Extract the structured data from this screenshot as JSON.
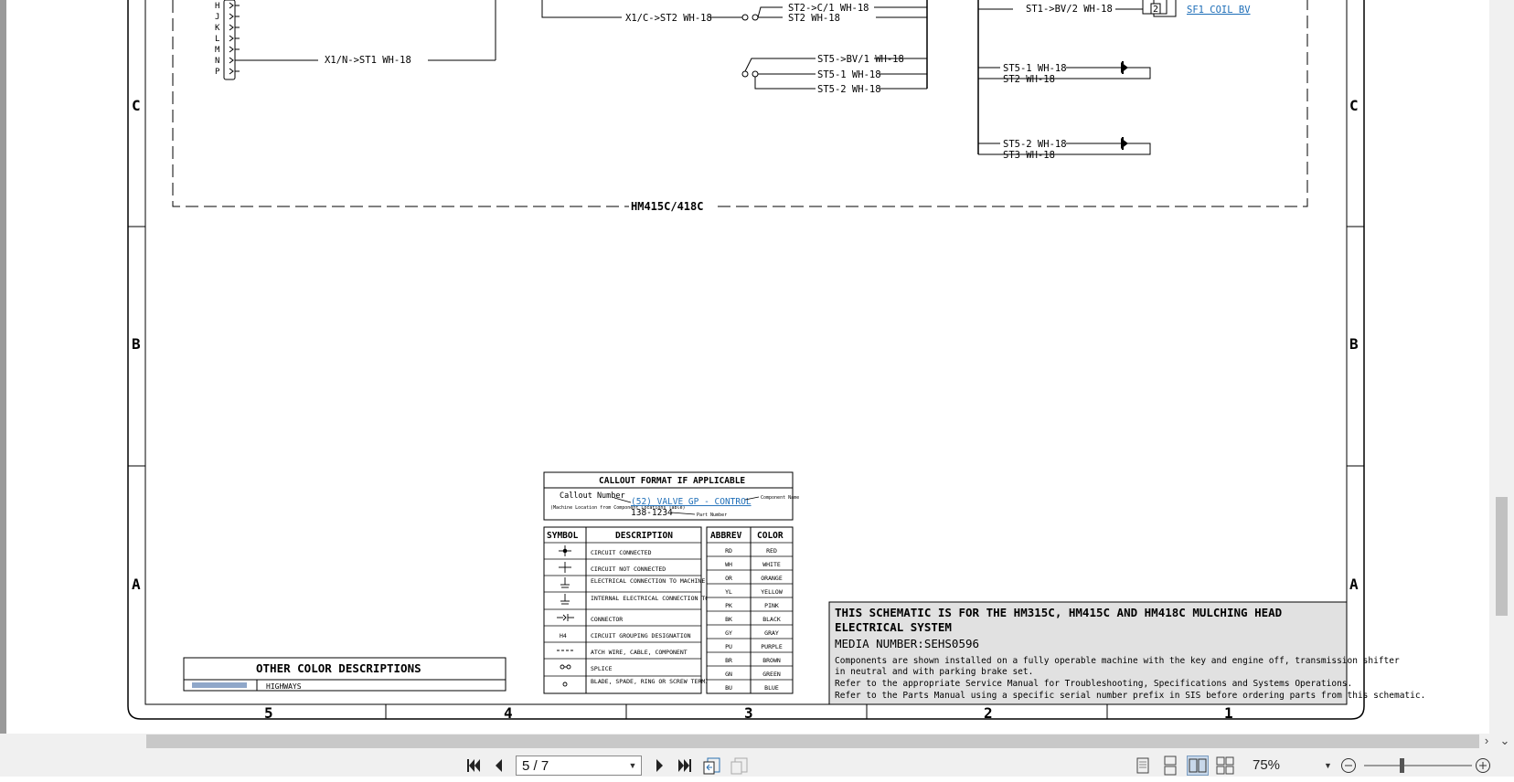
{
  "schematic": {
    "pins": [
      "H",
      "J",
      "K",
      "L",
      "M",
      "N",
      "P"
    ],
    "wires": {
      "x1n_st1": "X1/N->ST1 WH-18",
      "x1c_st2": "X1/C->ST2 WH-18",
      "st2_c1": "ST2->C/1 WH-18",
      "st2": "ST2 WH-18",
      "st5_bv1": "ST5->BV/1 WH-18",
      "st5_1": "ST5-1 WH-18",
      "st5_2": "ST5-2 WH-18",
      "st1_bv2": "ST1->BV/2 WH-18",
      "st5_1b": "ST5-1 WH-18",
      "st2b": "ST2 WH-18",
      "st5_2b": "ST5-2 WH-18",
      "st3": "ST3 WH-18"
    },
    "component_link": "SF1 COIL BV",
    "connector_pin": "2",
    "zone_label": "HM415C/418C"
  },
  "border": {
    "rows": [
      "C",
      "B",
      "A"
    ],
    "columns": [
      "5",
      "4",
      "3",
      "2",
      "1"
    ]
  },
  "callout": {
    "title": "CALLOUT FORMAT IF APPLICABLE",
    "callout_number": "Callout Number",
    "callout_note": "(Machine Location from Component Locations Table)",
    "link": "(52) VALVE GP - CONTROL",
    "component_name": "Component Name",
    "part_number_value": "138-1234",
    "part_number_label": "Part Number"
  },
  "symbol_table": {
    "headers": [
      "SYMBOL",
      "DESCRIPTION"
    ],
    "rows": [
      {
        "icon": "circuit-connected-icon",
        "desc": "CIRCUIT CONNECTED"
      },
      {
        "icon": "circuit-not-connected-icon",
        "desc": "CIRCUIT NOT CONNECTED"
      },
      {
        "icon": "ground-structure-icon",
        "desc": "ELECTRICAL CONNECTION TO MACHINE STRUCTURE"
      },
      {
        "icon": "ground-internal-icon",
        "desc": "INTERNAL ELECTRICAL CONNECTION TO SURFACE OF COMPONENT"
      },
      {
        "icon": "connector-icon",
        "desc": "CONNECTOR"
      },
      {
        "icon": "grouping-icon",
        "symbol_text": "H4",
        "desc": "CIRCUIT GROUPING DESIGNATION"
      },
      {
        "icon": "attach-wire-icon",
        "desc": "ATCH WIRE, CABLE, COMPONENT"
      },
      {
        "icon": "splice-icon",
        "desc": "SPLICE"
      },
      {
        "icon": "terminal-icon",
        "desc": "BLADE, SPADE, RING OR SCREW TERMINAL"
      }
    ]
  },
  "color_table": {
    "headers": [
      "ABBREV",
      "COLOR"
    ],
    "rows": [
      [
        "RD",
        "RED"
      ],
      [
        "WH",
        "WHITE"
      ],
      [
        "OR",
        "ORANGE"
      ],
      [
        "YL",
        "YELLOW"
      ],
      [
        "PK",
        "PINK"
      ],
      [
        "BK",
        "BLACK"
      ],
      [
        "GY",
        "GRAY"
      ],
      [
        "PU",
        "PURPLE"
      ],
      [
        "BR",
        "BROWN"
      ],
      [
        "GN",
        "GREEN"
      ],
      [
        "BU",
        "BLUE"
      ]
    ]
  },
  "other_colors": {
    "title": "OTHER COLOR DESCRIPTIONS",
    "rows": [
      {
        "swatch": "#8fa7c9",
        "label": "HIGHWAYS"
      }
    ]
  },
  "title_block": {
    "heading_line1": "THIS SCHEMATIC IS FOR THE HM315C, HM415C AND HM418C MULCHING HEAD",
    "heading_line2": "ELECTRICAL SYSTEM",
    "media": "MEDIA NUMBER:SEHS0596",
    "note1a": "Components are shown installed on a fully operable machine with the key and engine off, transmission shifter",
    "note1b": "in neutral and with parking brake set.",
    "note2": "Refer to the appropriate Service Manual for Troubleshooting, Specifications and Systems Operations.",
    "note3": "Refer to the Parts Manual using a specific serial number prefix in SIS before ordering parts from this schematic."
  },
  "viewer": {
    "page_value": "5 / 7",
    "zoom": "75%"
  }
}
